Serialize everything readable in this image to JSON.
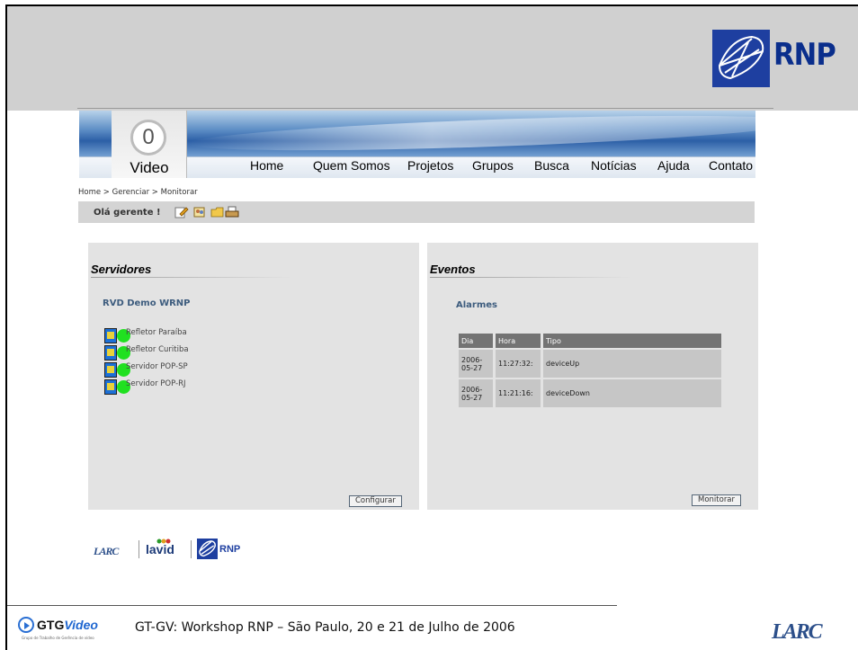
{
  "slide": {
    "footer_caption": "GT-GV: Workshop RNP – São Paulo, 20 e 21 de Julho de 2006",
    "gtg_logo_main": "GTG",
    "gtg_logo_accent": "Video",
    "gtg_logo_sub": "Grupo de Trabalho de Gerência de vídeo",
    "rnp_logo_text": "RNP",
    "larc_logo_text": "LARC"
  },
  "site": {
    "video_digit": "0",
    "video_label": "Video",
    "nav": [
      "Home",
      "Quem Somos",
      "Projetos",
      "Grupos",
      "Busca",
      "Notícias",
      "Ajuda",
      "Contato"
    ],
    "breadcrumb": "Home > Gerenciar > Monitorar",
    "greeting": "Olá gerente !",
    "toolbar_icons": [
      "edit-icon",
      "users-icon",
      "folder-icon",
      "print-icon"
    ]
  },
  "servers_panel": {
    "title": "Servidores",
    "group": "RVD Demo WRNP",
    "servers": [
      {
        "name": "Refletor Paraíba",
        "status": "up"
      },
      {
        "name": "Refletor Curitiba",
        "status": "up"
      },
      {
        "name": "Servidor POP-SP",
        "status": "up"
      },
      {
        "name": "Servidor POP-RJ",
        "status": "up"
      }
    ],
    "button": "Configurar"
  },
  "events_panel": {
    "title": "Eventos",
    "subtitle": "Alarmes",
    "columns": [
      "Dia",
      "Hora",
      "Tipo"
    ],
    "rows": [
      {
        "dia_line1": "2006-",
        "dia_line2": "05-27",
        "hora": "11:27:32:",
        "tipo": "deviceUp"
      },
      {
        "dia_line1": "2006-",
        "dia_line2": "05-27",
        "hora": "11:21:16:",
        "tipo": "deviceDown"
      }
    ],
    "button": "Monitorar"
  },
  "partners": {
    "larc": "LARC",
    "lavid": "lavid",
    "rnp": "RNP"
  },
  "colors": {
    "status_up": "#20e020",
    "rnp_blue": "#1e3fa0",
    "panel_bg": "#e3e3e3",
    "table_header": "#737373"
  }
}
